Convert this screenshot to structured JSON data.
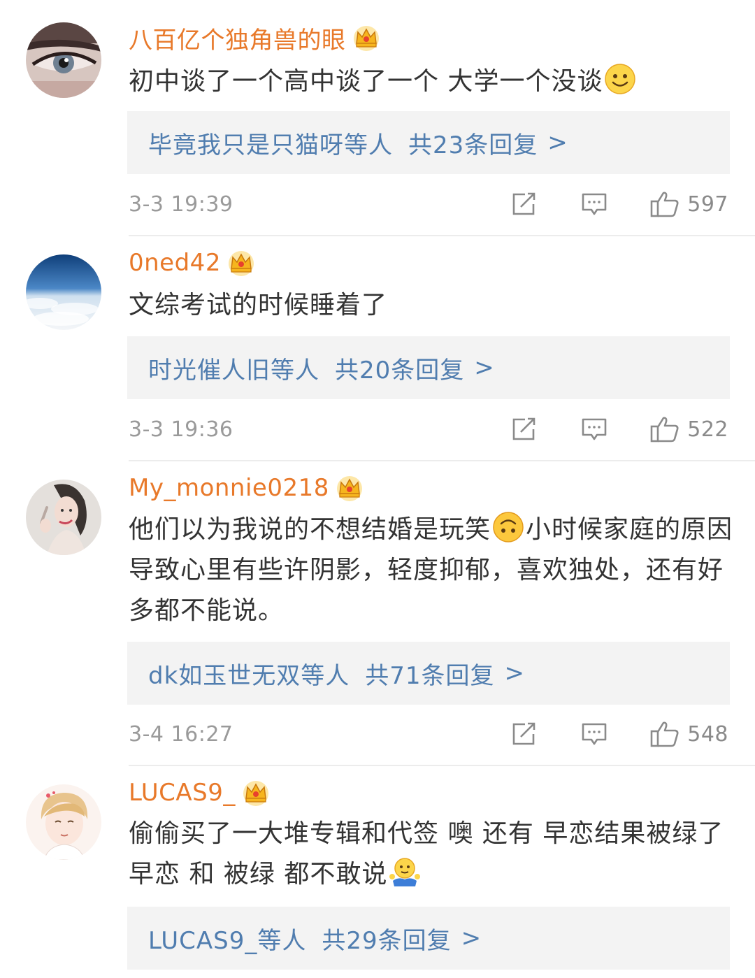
{
  "comments": [
    {
      "username": "八百亿个独角兽的眼",
      "badge": "crown-icon",
      "text": "初中谈了一个高中谈了一个 大学一个没谈",
      "emoji": "smile-emoji",
      "reply_from": "毕竟我只是只猫呀等人",
      "reply_count": "共23条回复",
      "reply_chevron": ">",
      "time": "3-3 19:39",
      "likes": "597"
    },
    {
      "username": "0ned42",
      "badge": "crown-icon",
      "text": "文综考试的时候睡着了",
      "reply_from": "时光催人旧等人",
      "reply_count": "共20条回复",
      "reply_chevron": ">",
      "time": "3-3 19:36",
      "likes": "522"
    },
    {
      "username": "My_monnie0218",
      "badge": "crown-icon",
      "text_part1": "他们以为我说的不想结婚是玩笑",
      "emoji": "upside-down-face-emoji",
      "text_part2": "小时候家庭的原因导致心里有些许阴影，轻度抑郁，喜欢独处，还有好多都不能说。",
      "reply_from": "dk如玉世无双等人",
      "reply_count": "共71条回复",
      "reply_chevron": ">",
      "time": "3-4 16:27",
      "likes": "548"
    },
    {
      "username": "LUCAS9_",
      "badge": "crown-icon",
      "text": "偷偷买了一大堆专辑和代签 噢 还有 早恋结果被绿了 早恋 和 被绿 都不敢说",
      "emoji": "shrug-emoji",
      "reply_from": "LUCAS9_等人",
      "reply_count": "共29条回复",
      "reply_chevron": ">"
    }
  ],
  "colors": {
    "username": "#e8792a",
    "reply_link": "#507daf",
    "reply_bg": "#f3f3f3",
    "meta": "#9a9a9a",
    "text": "#333333"
  }
}
